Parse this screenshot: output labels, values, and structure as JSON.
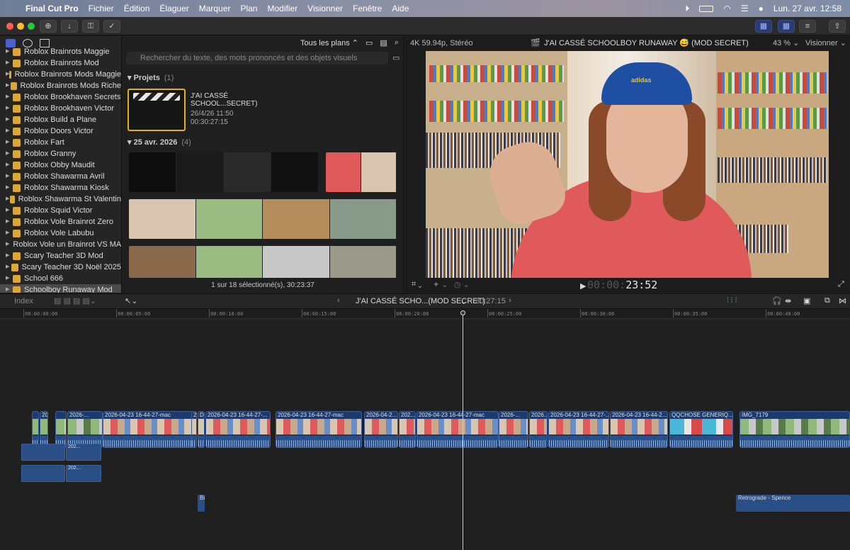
{
  "menubar": {
    "app_name": "Final Cut Pro",
    "items": [
      "Fichier",
      "Édition",
      "Élaguer",
      "Marquer",
      "Plan",
      "Modifier",
      "Visionner",
      "Fenêtre",
      "Aide"
    ],
    "clock": "Lun. 27 avr.  12:58"
  },
  "browser": {
    "filter_label": "Tous les plans",
    "search_placeholder": "Rechercher du texte, des mots prononcés et des objets visuels",
    "projects_section": "Projets",
    "projects_count": "(1)",
    "project": {
      "title_line1": "J'AI CASSÉ",
      "title_line2": "SCHOOL...SECRET)",
      "date": "26/4/26 11:50",
      "duration": "00:30:27:15"
    },
    "date_section": "25 avr. 2026",
    "date_count": "(4)",
    "status": "1 sur 18 sélectionné(s), 30:23:37"
  },
  "libraries": [
    {
      "label": "Roblox Brainrots Maggie",
      "selected": false
    },
    {
      "label": "Roblox Brainrots Mod",
      "selected": false
    },
    {
      "label": "Roblox Brainrots Mods Maggie",
      "selected": false
    },
    {
      "label": "Roblox Brainrots Mods Riche",
      "selected": false
    },
    {
      "label": "Roblox Brookhaven Secrets",
      "selected": false
    },
    {
      "label": "Roblox Brookhaven Victor",
      "selected": false
    },
    {
      "label": "Roblox Build a Plane",
      "selected": false
    },
    {
      "label": "Roblox Doors Victor",
      "selected": false
    },
    {
      "label": "Roblox Fart",
      "selected": false
    },
    {
      "label": "Roblox Granny",
      "selected": false
    },
    {
      "label": "Roblox Obby Maudit",
      "selected": false
    },
    {
      "label": "Roblox Shawarma Avril",
      "selected": false
    },
    {
      "label": "Roblox Shawarma Kiosk",
      "selected": false
    },
    {
      "label": "Roblox Shawarma St Valentin",
      "selected": false
    },
    {
      "label": "Roblox Squid Victor",
      "selected": false
    },
    {
      "label": "Roblox Vole Brainrot Zero",
      "selected": false
    },
    {
      "label": "Roblox Vole Labubu",
      "selected": false
    },
    {
      "label": "Roblox Vole un Brainrot VS MA...",
      "selected": false
    },
    {
      "label": "Scary Teacher 3D Mod",
      "selected": false
    },
    {
      "label": "Scary Teacher 3D Noël 2025",
      "selected": false
    },
    {
      "label": "School 666",
      "selected": false
    },
    {
      "label": "Schoolboy Runaway Mod",
      "selected": true
    }
  ],
  "viewer": {
    "format": "4K 59.94p, Stéréo",
    "title": "J'AI CASSÉ SCHOOLBOY RUNAWAY 😅 (MOD SECRET)",
    "zoom": "43 %",
    "view_menu": "Visionner",
    "timecode_dim": "00:00:",
    "timecode": "23:52",
    "cap_logo": "adidas"
  },
  "timeline": {
    "index_label": "Index",
    "project_name": "J'AI CASSÉ SCHO...(MOD SECRET)",
    "duration": "30:27:15",
    "ruler": [
      "00:00:00:00",
      "00:00:05:00",
      "00:00:10:00",
      "00:00:15:00",
      "00:00:20:00",
      "00:00:25:00",
      "00:00:30:00",
      "00:00:35:00",
      "00:00:40:00"
    ],
    "clips": [
      {
        "name": "",
        "kind": "alt"
      },
      {
        "name": "20",
        "kind": "alt"
      },
      {
        "name": "",
        "kind": "alt"
      },
      {
        "name": "2026-...",
        "kind": "alt"
      },
      {
        "name": "2026-04-23 16-44-27-mac",
        "kind": "main"
      },
      {
        "name": "2",
        "kind": "main"
      },
      {
        "name": "D",
        "kind": "main"
      },
      {
        "name": "2026-04-23 16-44-27-...",
        "kind": "main"
      },
      {
        "name": "2026-04-23 16-44-27-mac",
        "kind": "main"
      },
      {
        "name": "2026-04-2...",
        "kind": "main"
      },
      {
        "name": "202...",
        "kind": "main"
      },
      {
        "name": "2026-04-23 16-44-27-mac",
        "kind": "main"
      },
      {
        "name": "2026-...",
        "kind": "main"
      },
      {
        "name": "2026...",
        "kind": "main"
      },
      {
        "name": "2026-04-23 16-44-27-...",
        "kind": "main"
      },
      {
        "name": "2026-04-23 16-44-2...",
        "kind": "main"
      },
      {
        "name": "QQCHOSE GENERIQ...",
        "kind": "title"
      },
      {
        "name": "IMG_7179",
        "kind": "alt"
      }
    ],
    "audio_clip_label": "202...",
    "broll_label": "Bi",
    "music_label": "Retrograde - Spence"
  }
}
